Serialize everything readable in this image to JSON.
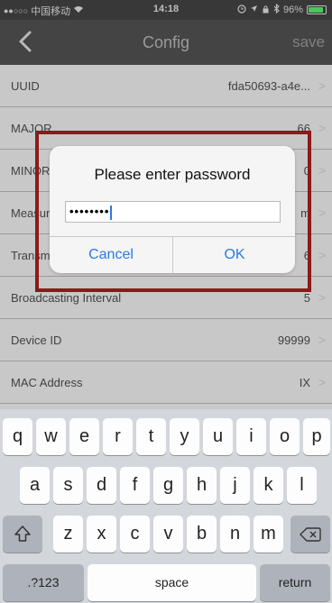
{
  "status_bar": {
    "carrier": "中国移动",
    "time": "14:18",
    "battery": "96%",
    "signal_dots": "●●○○○",
    "wifi_icon": "wifi-icon",
    "alarm_icon": "alarm-icon",
    "location_icon": "location-arrow-icon",
    "lock_icon": "orientation-lock-icon",
    "bluetooth_icon": "bluetooth-icon"
  },
  "nav": {
    "title": "Config",
    "save_label": "save",
    "back_icon": "chevron-left-icon"
  },
  "rows": [
    {
      "label": "UUID",
      "value": "fda50693-a4e..."
    },
    {
      "label": "MAJOR",
      "value": "66"
    },
    {
      "label": "MINOR",
      "value": "0"
    },
    {
      "label": "Measur",
      "value": "m"
    },
    {
      "label": "Transm",
      "value": "6"
    },
    {
      "label": "Broadcasting Interval",
      "value": "5"
    },
    {
      "label": "Device ID",
      "value": "99999"
    },
    {
      "label": "MAC Address",
      "value": "IX"
    }
  ],
  "alert": {
    "title": "Please enter password",
    "input_value": "••••••••",
    "cancel_label": "Cancel",
    "ok_label": "OK"
  },
  "keyboard": {
    "row1": [
      "q",
      "w",
      "e",
      "r",
      "t",
      "y",
      "u",
      "i",
      "o",
      "p"
    ],
    "row2": [
      "a",
      "s",
      "d",
      "f",
      "g",
      "h",
      "j",
      "k",
      "l"
    ],
    "row3": [
      "z",
      "x",
      "c",
      "v",
      "b",
      "n",
      "m"
    ],
    "shift_symbol": "⇧",
    "numbers_label": ".?123",
    "space_label": "space",
    "return_label": "return"
  },
  "colors": {
    "accent": "#2a7ae2",
    "annotation_frame": "#8b1a1a",
    "nav_bar": "#4a4a4a",
    "status_bar": "#3d3d3d",
    "battery_fill": "#4cd964"
  }
}
